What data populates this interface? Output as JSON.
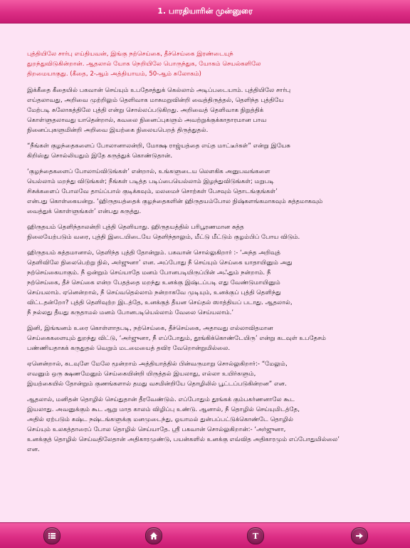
{
  "header": {
    "title": "1. பாரதியாரின் முன்னுரை"
  },
  "content": {
    "paragraphs": [
      {
        "style": "red",
        "text": "புத்தியிலே சார்பு எய்தியவன், இங்கு நற்செய்கை, தீச்செய்கை இரண்டையுந்\nதுறந்துவிடுகின்றான். ஆதலால் யோக நெறியிலே பொருந்துக, யோகம் செயல்களிலே\nதிறமையாகுது. (கீதை, 2-ஆம் அத்தியாயம், 50-ஆம் சுலோகம்)"
      },
      {
        "style": "normal",
        "text": "இக்கீதை கீதையில் பகவான் செய்யும் உபதேசத்துக் கெல்லாம் அடிப்படையாம். புத்தியிலே சார்பு\nஎய்தலாவது, அறிவை முற்றிலும் தெளிவாக மாசுமறுவின்றி வைத்திருத்தல், தெளிந்த புத்தியே\nமேற்படி சுலோகத்திலே புத்தி என்று சொல்லப்படுகிறது. அறிவைத் தெளிவாக நிறுத்திக்\nகொள்ளுதலாவது யாதென்றால், கவலை நினைப்புகளும் அவற்றுக்குக்காதாரமான பாவ\nநினைப்புகளுமின்றி அறிவை இயற்கை நிலையபெறத் திருத்துதல்."
      },
      {
        "style": "normal",
        "text": "“நீங்கள் குழந்தைகளைப் போலானாலன்றி, மோக்ஷ ராஜ்யத்தை எய்த மாட்டீர்கள்” என்று இயேசு\nகிறிஸ்து சொல்லியதும் இதே கருத்துக் கொண்டுதான்."
      },
      {
        "style": "normal",
        "text": "‘குழந்தைகளைப் போலாய்விடுங்கள்’ என்றால், உங்களுடைய லௌகிக அனுபவங்களை\nயெல்லாம் மறந்து விடுங்கள்; நீங்கள் படித்த படிப்பையெல்லாம் இழந்துவிடுங்கள்; மறுபடி\nசிசுக்களைப் போலவே தாய்ப்பால் குடிக்கவும், மலமைச் சொற்கள் பேசவும் தொடங்குங்கள்’\nஎன்பது கொள்கையன்று. ‘ஹிருதயத்தைக் குழந்தைகளின் ஹிருதயம்போல நிஷ்களங்கமாகவும் சுத்தமாகவும்\nவைத்துக் கொள்ளுங்கள்’ என்பது கருத்து."
      },
      {
        "style": "normal",
        "text": "ஹிருதயம் தெளிந்தாலன்றி புத்தி தெளியாது. ஹிருதயத்தில் பரிபூரணமான சுத்த\nநிலையேற்படும் வரை, புத்தி இடையிடையே தெளிந்தாலும், மீட்டு மீட்டும் குழம்பிப் போய விடும்."
      },
      {
        "style": "normal",
        "text": "ஹிருதயம் சுத்தமானால், தெளிந்த புத்தி தோன்றும். பகவான் சொல்லுகிறார் :- ‘அந்த அறிவுத்\nதெளிவிலே நிலைபெற்று நில், அர்ஜுனா’ என. அப்போது நீ செய்யும் செய்கை யாதாயினும் அது\nநற்செய்கையாகும். நீ ஒன்றும் செய்யாதே மனம் போனபடியிருப்பின் அஃதும் நன்றாம். நீ\nநற்செய்கை, தீச் செய்கை என்ற பேதத்தை மறந்து உனக்கு இஷ்டப்படி எது வேண்டுமாயினும்\nசெய்யலாம். ஏனென்றால், நீ செய்வதெல்லாம் நன்றாகவே முடியும், உனக்குப் புத்தி தெளிந்து\nவிட்டதன்றோ? புத்தி தெளிவுற்ற இடத்தே, உனக்குத் தீயன செய்தல் ஸாத்தியப் படாது. ஆதலால்,\nநீ நல்லது தீயது கருதாமல் மனம் போனபடியெல்லாம் வேலை செய்யலாம்.’"
      },
      {
        "style": "normal",
        "text": "இனி, இங்ஙனம் உரை கொள்ளாதபடி, நற்செய்கை, தீச்செய்கை, அதாவது எல்லாவிதமான\nசெய்கைகளையும் துறந்து விட்டு, ‘அர்ஜுனா, நீ எப்போதும், தூங்கிக்கொண்டேயிரு’ என்று கடவுள் உபதேசம்\nபண்ணியதாகக் கருதுதல் வெறும் மடமையைத் தவிர வேறொன்றுமில்லை."
      },
      {
        "style": "normal",
        "text": "ஏனென்றால், கடவுளே மேலே மூன்றாம் அத்தியாத்தில் பின்வருமாறு சொல்லுகிறார்:- “மேலும்,\nஎவனும் ஒரு க்ஷணமேனும் செய்கையின்றி யிருத்தல் இயலாது, எல்லா உயிர்களும்,\nஇயற்கையில் தோன்றும் குணங்களால் தமது வசமின்றியே தொழிலில் பூட்டப்படுகின்றன” என."
      },
      {
        "style": "normal",
        "text": "ஆதலால், மனிதன் தொழில் செய்துதான் தீரவேண்டும். எப்போதும் தூங்கக் கும்பகர்ணனாலே கூட\nஇயலாது. அவனுக்கும் கூட ஆறு மாத காலம் விழிப்பு உண்டு. ஆனால், நீ தொழில் செய்யுமிடத்தே,\nஅதில் ஏற்படும் கஷ்ட நஷ்டங்களுக்கு மனமுடைந்து, ஓயாமல் துன்பப்பட்டுக்கொண்டே தொழில்\nசெய்யும் உலகத்தாரைப் போல தொழில் செய்யாதே. ஸ்ரீ பகவான் சொல்லுகிறான்:- ‘அர்ஜுனா,\nஉனக்குத் தொழில் செய்வதிலேதான் அதிகாரமுண்டு, பயன்களில் உனக்கு எவ்வித அதிகாரமும் எப்போதுமில்லை’\nஎன."
      }
    ]
  },
  "footer": {
    "buttons": [
      {
        "name": "list-button",
        "icon": "list-icon"
      },
      {
        "name": "home-button",
        "icon": "home-icon"
      },
      {
        "name": "text-size-button",
        "icon": "text-size-icon",
        "label": "T"
      },
      {
        "name": "next-button",
        "icon": "arrow-right-icon"
      }
    ]
  },
  "colors": {
    "bar": "#dc2e85",
    "background": "#fde3f4",
    "highlight_text": "#cc1f2d",
    "body_text": "#1a1a1a"
  }
}
